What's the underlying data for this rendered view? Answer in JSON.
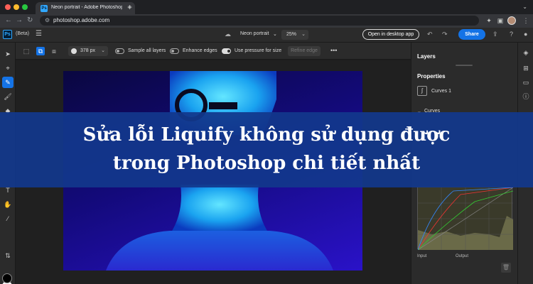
{
  "browser": {
    "tab_title": "Neon portrait - Adobe Photoshop",
    "tab_favicon_text": "Ps",
    "new_tab_label": "+",
    "url": "photoshop.adobe.com"
  },
  "app": {
    "logo_text": "Ps",
    "beta_label": "(Beta)",
    "document_name": "Neon portrait",
    "zoom_value": "25%",
    "open_desktop_label": "Open in desktop app",
    "share_label": "Share"
  },
  "options": {
    "brush_size": "378 px",
    "sample_all_layers_label": "Sample all layers",
    "enhance_edges_label": "Enhance edges",
    "use_pressure_label": "Use pressure for size",
    "refine_edge_label": "Refine edge",
    "use_pressure_on": true
  },
  "panels": {
    "layers_title": "Layers",
    "properties_title": "Properties",
    "curves_layer_label": "Curves 1",
    "curves_section_label": "Curves",
    "input_label": "Input",
    "output_label": "Output"
  },
  "banner": {
    "line1": "Sửa lỗi Liquify không sử dụng được",
    "line2": "trong Photoshop chi tiết nhất"
  },
  "colors": {
    "accent": "#1473e6",
    "banner_bg": "#12388c",
    "photo_blue": "#2a12c8"
  }
}
